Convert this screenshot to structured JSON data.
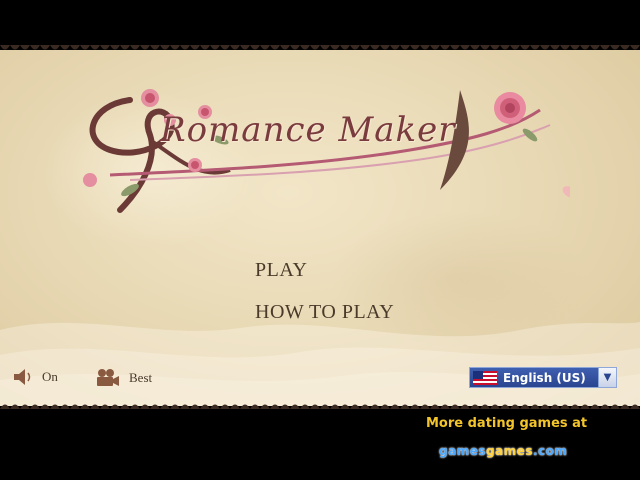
{
  "logo": {
    "title": "Romance Maker"
  },
  "menu": {
    "play": "PLAY",
    "how_to_play": "HOW TO PLAY"
  },
  "controls": {
    "sound": {
      "label": "On",
      "icon": "speaker-icon"
    },
    "quality": {
      "label": "Best",
      "icon": "camera-icon"
    }
  },
  "language": {
    "selected": "English (US)",
    "flag": "us-flag-icon"
  },
  "footer": {
    "promo": "More dating games at",
    "brand_a": "games",
    "brand_b": "games",
    "brand_c": ".com"
  },
  "colors": {
    "parchment": "#e9dab6",
    "accent": "#7a3b3f",
    "promo": "#f3c52b",
    "lang_bg": "#2a4590"
  }
}
